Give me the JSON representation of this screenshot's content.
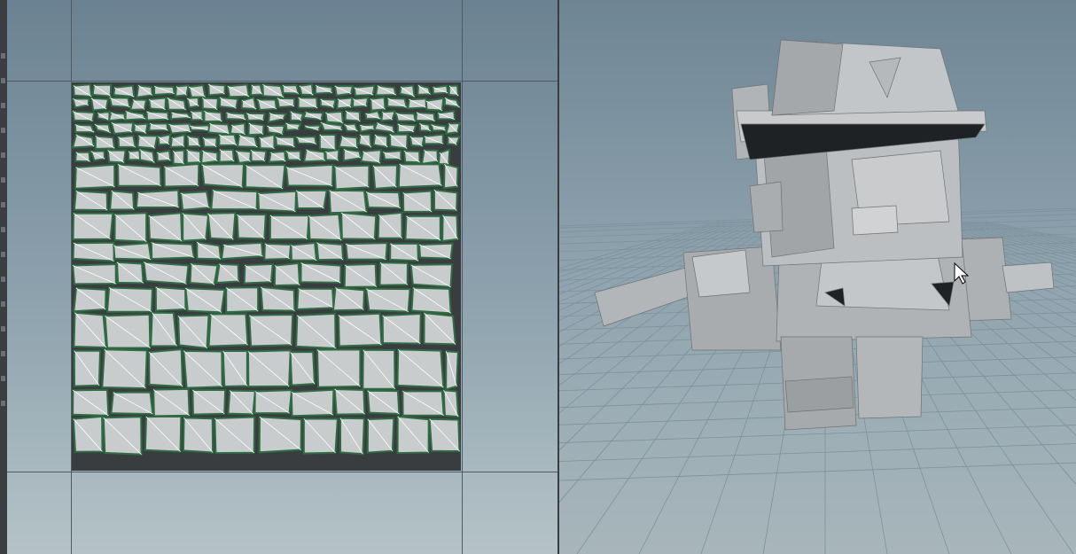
{
  "viewports": [
    {
      "name": "uv",
      "content": "uv-layout-islands"
    },
    {
      "name": "perspective",
      "content": "low-poly-character-model"
    }
  ],
  "icons": {
    "cursor": "arrow-cursor-icon"
  },
  "colors": {
    "uv_island_fill": "#c9cccd",
    "uv_island_border": "#2f6b43",
    "uv_tile_bg": "#3a3d3f",
    "model_shade": "#b9bcbf"
  }
}
